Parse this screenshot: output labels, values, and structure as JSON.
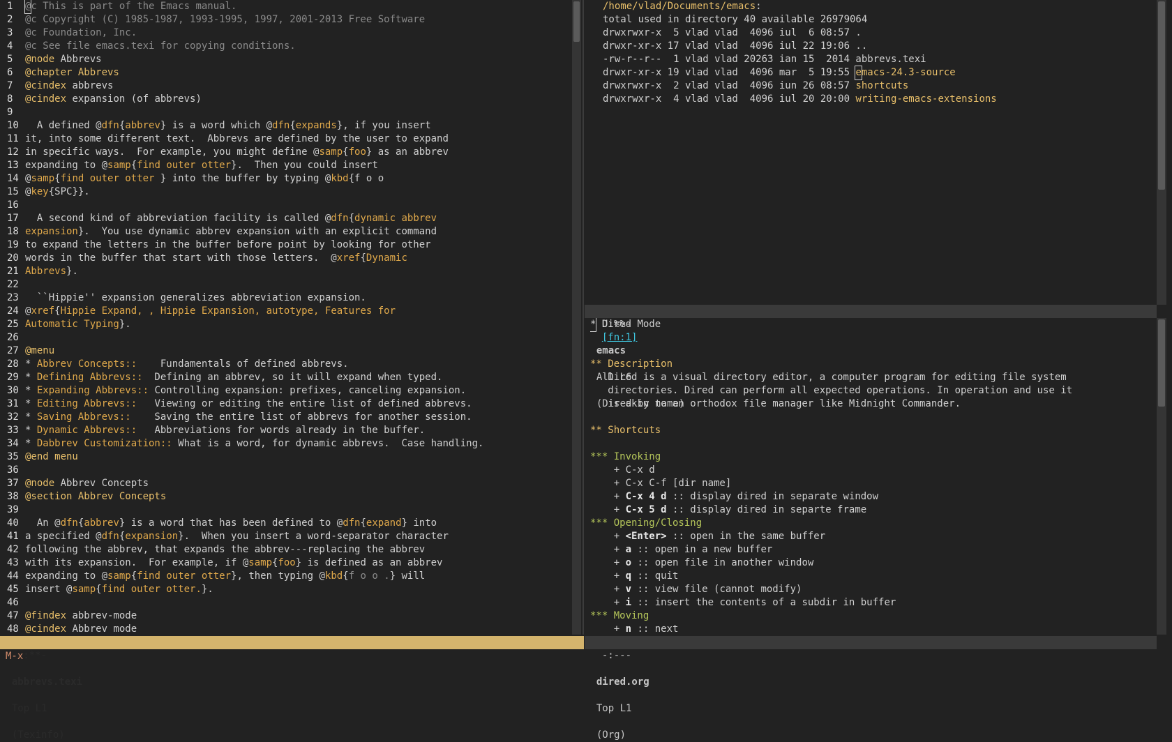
{
  "left_buffer": {
    "lines": [
      [
        [
          "cmt",
          "@c This is part of the Emacs manual."
        ]
      ],
      [
        [
          "cmt",
          "@c Copyright (C) 1985-1987, 1993-1995, 1997, 2001-2013 Free Software"
        ]
      ],
      [
        [
          "cmt",
          "@c Foundation, Inc."
        ]
      ],
      [
        [
          "cmt",
          "@c See file emacs.texi for copying conditions."
        ]
      ],
      [
        [
          "kw",
          "@node"
        ],
        [
          "t",
          " Abbrevs"
        ]
      ],
      [
        [
          "kw",
          "@chapter Abbrevs"
        ]
      ],
      [
        [
          "kw",
          "@cindex"
        ],
        [
          "t",
          " abbrevs"
        ]
      ],
      [
        [
          "kw",
          "@cindex"
        ],
        [
          "t",
          " expansion (of abbrevs)"
        ]
      ],
      [],
      [
        [
          "t",
          "  A defined @"
        ],
        [
          "arg",
          "dfn"
        ],
        [
          "t",
          "{"
        ],
        [
          "arg",
          "abbrev"
        ],
        [
          "t",
          "} is a word which @"
        ],
        [
          "arg",
          "dfn"
        ],
        [
          "t",
          "{"
        ],
        [
          "arg",
          "expands"
        ],
        [
          "t",
          "}, if you insert"
        ]
      ],
      [
        [
          "t",
          "it, into some different text.  Abbrevs are defined by the user to expand"
        ]
      ],
      [
        [
          "t",
          "in specific ways.  For example, you might define @"
        ],
        [
          "arg",
          "samp"
        ],
        [
          "t",
          "{"
        ],
        [
          "arg",
          "foo"
        ],
        [
          "t",
          "} as an abbrev"
        ]
      ],
      [
        [
          "t",
          "expanding to @"
        ],
        [
          "arg",
          "samp"
        ],
        [
          "t",
          "{"
        ],
        [
          "arg",
          "find outer otter"
        ],
        [
          "t",
          "}.  Then you could insert"
        ]
      ],
      [
        [
          "t",
          "@"
        ],
        [
          "arg",
          "samp"
        ],
        [
          "t",
          "{"
        ],
        [
          "arg",
          "find outer otter "
        ],
        [
          "t",
          "} into the buffer by typing @"
        ],
        [
          "arg",
          "kbd"
        ],
        [
          "t",
          "{f o o"
        ]
      ],
      [
        [
          "t",
          "@"
        ],
        [
          "arg",
          "key"
        ],
        [
          "t",
          "{SPC}}."
        ]
      ],
      [],
      [
        [
          "t",
          "  A second kind of abbreviation facility is called @"
        ],
        [
          "arg",
          "dfn"
        ],
        [
          "t",
          "{"
        ],
        [
          "arg",
          "dynamic abbrev"
        ]
      ],
      [
        [
          "arg",
          "expansion"
        ],
        [
          "t",
          "}.  You use dynamic abbrev expansion with an explicit command"
        ]
      ],
      [
        [
          "t",
          "to expand the letters in the buffer before point by looking for other"
        ]
      ],
      [
        [
          "t",
          "words in the buffer that start with those letters.  @"
        ],
        [
          "arg",
          "xref"
        ],
        [
          "t",
          "{"
        ],
        [
          "arg",
          "Dynamic"
        ]
      ],
      [
        [
          "arg",
          "Abbrevs"
        ],
        [
          "t",
          "}."
        ]
      ],
      [],
      [
        [
          "t",
          "  ``Hippie'' expansion generalizes abbreviation expansion."
        ]
      ],
      [
        [
          "t",
          "@"
        ],
        [
          "arg",
          "xref"
        ],
        [
          "t",
          "{"
        ],
        [
          "arg",
          "Hippie Expand, , Hippie Expansion, autotype, Features for"
        ]
      ],
      [
        [
          "arg",
          "Automatic Typing"
        ],
        [
          "t",
          "}."
        ]
      ],
      [],
      [
        [
          "kw",
          "@menu"
        ]
      ],
      [
        [
          "t",
          "* "
        ],
        [
          "arg",
          "Abbrev Concepts::"
        ],
        [
          "t",
          "    Fundamentals of defined abbrevs."
        ]
      ],
      [
        [
          "t",
          "* "
        ],
        [
          "arg",
          "Defining Abbrevs::"
        ],
        [
          "t",
          "  Defining an abbrev, so it will expand when typed."
        ]
      ],
      [
        [
          "t",
          "* "
        ],
        [
          "arg",
          "Expanding Abbrevs::"
        ],
        [
          "t",
          " Controlling expansion: prefixes, canceling expansion."
        ]
      ],
      [
        [
          "t",
          "* "
        ],
        [
          "arg",
          "Editing Abbrevs::"
        ],
        [
          "t",
          "   Viewing or editing the entire list of defined abbrevs."
        ]
      ],
      [
        [
          "t",
          "* "
        ],
        [
          "arg",
          "Saving Abbrevs::"
        ],
        [
          "t",
          "    Saving the entire list of abbrevs for another session."
        ]
      ],
      [
        [
          "t",
          "* "
        ],
        [
          "arg",
          "Dynamic Abbrevs::"
        ],
        [
          "t",
          "   Abbreviations for words already in the buffer."
        ]
      ],
      [
        [
          "t",
          "* "
        ],
        [
          "arg",
          "Dabbrev Customization::"
        ],
        [
          "t",
          " What is a word, for dynamic abbrevs.  Case handling."
        ]
      ],
      [
        [
          "kw",
          "@end menu"
        ]
      ],
      [],
      [
        [
          "kw",
          "@node"
        ],
        [
          "t",
          " Abbrev Concepts"
        ]
      ],
      [
        [
          "kw",
          "@section Abbrev Concepts"
        ]
      ],
      [],
      [
        [
          "t",
          "  An @"
        ],
        [
          "arg",
          "dfn"
        ],
        [
          "t",
          "{"
        ],
        [
          "arg",
          "abbrev"
        ],
        [
          "t",
          "} is a word that has been defined to @"
        ],
        [
          "arg",
          "dfn"
        ],
        [
          "t",
          "{"
        ],
        [
          "arg",
          "expand"
        ],
        [
          "t",
          "} into"
        ]
      ],
      [
        [
          "t",
          "a specified @"
        ],
        [
          "arg",
          "dfn"
        ],
        [
          "t",
          "{"
        ],
        [
          "arg",
          "expansion"
        ],
        [
          "t",
          "}.  When you insert a word-separator character"
        ]
      ],
      [
        [
          "t",
          "following the abbrev, that expands the abbrev---replacing the abbrev"
        ]
      ],
      [
        [
          "t",
          "with its expansion.  For example, if @"
        ],
        [
          "arg",
          "samp"
        ],
        [
          "t",
          "{"
        ],
        [
          "arg",
          "foo"
        ],
        [
          "t",
          "} is defined as an abbrev"
        ]
      ],
      [
        [
          "t",
          "expanding to @"
        ],
        [
          "arg",
          "samp"
        ],
        [
          "t",
          "{"
        ],
        [
          "arg",
          "find outer otter"
        ],
        [
          "t",
          "}, then typing @"
        ],
        [
          "arg",
          "kbd"
        ],
        [
          "t",
          "{"
        ],
        [
          "cmt",
          "f o o ."
        ],
        [
          "t",
          "} will"
        ]
      ],
      [
        [
          "t",
          "insert @"
        ],
        [
          "arg",
          "samp"
        ],
        [
          "t",
          "{"
        ],
        [
          "arg",
          "find outer otter."
        ],
        [
          "t",
          "}."
        ]
      ],
      [],
      [
        [
          "kw",
          "@findex"
        ],
        [
          "t",
          " abbrev-mode"
        ]
      ],
      [
        [
          "kw",
          "@cindex"
        ],
        [
          "t",
          " Abbrev mode"
        ]
      ]
    ],
    "modeline": {
      "status": "-:**-",
      "name": "abbrevs.texi",
      "pos": "Top L1",
      "mode": "(Texinfo)"
    }
  },
  "dired": {
    "lines": [
      [
        [
          "dir",
          "/home/vlad/Documents/emacs"
        ],
        [
          "t",
          ":"
        ]
      ],
      [
        [
          "t",
          "total used in directory 40 available 26979064"
        ]
      ],
      [
        [
          "t",
          "drwxrwxr-x  5 vlad vlad  4096 iul  6 08:57 ."
        ]
      ],
      [
        [
          "t",
          "drwxr-xr-x 17 vlad vlad  4096 iul 22 19:06 .."
        ]
      ],
      [
        [
          "t",
          "-rw-r--r--  1 vlad vlad 20263 ian 15  2014 abbrevs.texi"
        ]
      ],
      [
        [
          "t",
          "drwxr-xr-x 19 vlad vlad  4096 mar  5 19:55 "
        ],
        [
          "dir",
          "emacs-24.3-source"
        ]
      ],
      [
        [
          "t",
          "drwxrwxr-x  2 vlad vlad  4096 iun 26 08:57 "
        ],
        [
          "dir",
          "shortcuts"
        ]
      ],
      [
        [
          "t",
          "drwxrwxr-x  4 vlad vlad  4096 iul 20 20:00 "
        ],
        [
          "dir",
          "writing-emacs-extensions"
        ]
      ]
    ],
    "modeline": {
      "status": "U:%%-",
      "name": "emacs",
      "pos": "All L6",
      "mode": "(Dired by name)"
    }
  },
  "org": {
    "lines": [
      [
        [
          "cur",
          "*"
        ],
        [
          "t",
          " Dired Mode"
        ]
      ],
      [
        [
          "t",
          "  "
        ],
        [
          "link",
          "[fn:1]"
        ]
      ],
      [],
      [
        [
          "org1",
          "** Description"
        ]
      ],
      [
        [
          "t",
          "   Dired is a visual directory editor, a computer program for editing file system"
        ]
      ],
      [
        [
          "t",
          "   directories. Dired can perform all expected operations. In operation and use it"
        ]
      ],
      [
        [
          "t",
          "   is akin to an orthodox file manager like Midnight Commander."
        ]
      ],
      [],
      [
        [
          "org1",
          "** Shortcuts"
        ]
      ],
      [],
      [
        [
          "org2",
          "*** Invoking"
        ]
      ],
      [
        [
          "t",
          "    + C-x d"
        ]
      ],
      [
        [
          "t",
          "    + C-x C-f [dir name]"
        ]
      ],
      [
        [
          "t",
          "    + "
        ],
        [
          "bold",
          "C-x 4 d"
        ],
        [
          "t",
          " :: display dired in separate window"
        ]
      ],
      [
        [
          "t",
          "    + "
        ],
        [
          "bold",
          "C-x 5 d"
        ],
        [
          "t",
          " :: display dired in separte frame"
        ]
      ],
      [
        [
          "org2",
          "*** Opening/Closing"
        ]
      ],
      [
        [
          "t",
          "    + "
        ],
        [
          "bold",
          "<Enter>"
        ],
        [
          "t",
          " :: open in the same buffer"
        ]
      ],
      [
        [
          "t",
          "    + "
        ],
        [
          "bold",
          "a"
        ],
        [
          "t",
          " :: open in a new buffer"
        ]
      ],
      [
        [
          "t",
          "    + "
        ],
        [
          "bold",
          "o"
        ],
        [
          "t",
          " :: open file in another window"
        ]
      ],
      [
        [
          "t",
          "    + "
        ],
        [
          "bold",
          "q"
        ],
        [
          "t",
          " :: quit"
        ]
      ],
      [
        [
          "t",
          "    + "
        ],
        [
          "bold",
          "v"
        ],
        [
          "t",
          " :: view file (cannot modify)"
        ]
      ],
      [
        [
          "t",
          "    + "
        ],
        [
          "bold",
          "i"
        ],
        [
          "t",
          " :: insert the contents of a subdir in buffer"
        ]
      ],
      [
        [
          "org2",
          "*** Moving"
        ]
      ],
      [
        [
          "t",
          "    + "
        ],
        [
          "bold",
          "n"
        ],
        [
          "t",
          " :: next"
        ]
      ]
    ],
    "modeline": {
      "status": "-:---",
      "name": "dired.org",
      "pos": "Top L1",
      "mode": "(Org)"
    }
  },
  "minibuffer": "M-x"
}
